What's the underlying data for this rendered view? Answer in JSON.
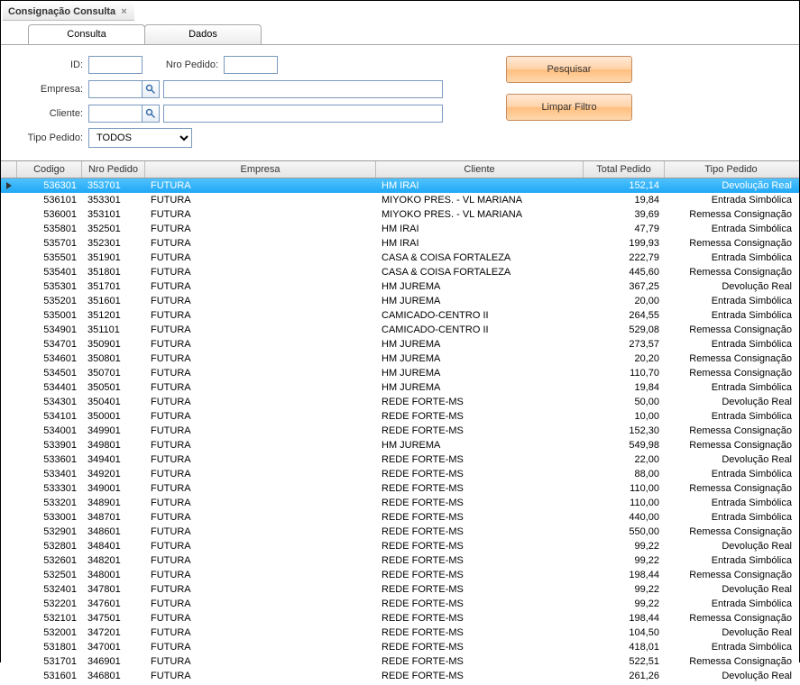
{
  "window": {
    "title": "Consignação Consulta"
  },
  "tabs": [
    {
      "label": "Consulta",
      "active": true
    },
    {
      "label": "Dados",
      "active": false
    }
  ],
  "form": {
    "id_label": "ID:",
    "id_value": "",
    "nro_label": "Nro Pedido:",
    "nro_value": "",
    "empresa_label": "Empresa:",
    "empresa_code": "",
    "empresa_name": "",
    "cliente_label": "Cliente:",
    "cliente_code": "",
    "cliente_name": "",
    "tipo_label": "Tipo Pedido:",
    "tipo_value": "TODOS"
  },
  "buttons": {
    "search": "Pesquisar",
    "clear": "Limpar Filtro"
  },
  "grid": {
    "columns": [
      "Codigo",
      "Nro Pedido",
      "Empresa",
      "Cliente",
      "Total Pedido",
      "Tipo Pedido"
    ],
    "rows": [
      {
        "codigo": "536301",
        "nro": "353701",
        "empresa": "FUTURA",
        "cliente": "HM IRAI",
        "total": "152,14",
        "tipo": "Devolução Real",
        "selected": true
      },
      {
        "codigo": "536101",
        "nro": "353301",
        "empresa": "FUTURA",
        "cliente": "MIYOKO PRES. - VL MARIANA",
        "total": "19,84",
        "tipo": "Entrada Simbólica"
      },
      {
        "codigo": "536001",
        "nro": "353101",
        "empresa": "FUTURA",
        "cliente": "MIYOKO PRES. - VL MARIANA",
        "total": "39,69",
        "tipo": "Remessa Consignação"
      },
      {
        "codigo": "535801",
        "nro": "352501",
        "empresa": "FUTURA",
        "cliente": "HM IRAI",
        "total": "47,79",
        "tipo": "Entrada Simbólica"
      },
      {
        "codigo": "535701",
        "nro": "352301",
        "empresa": "FUTURA",
        "cliente": "HM IRAI",
        "total": "199,93",
        "tipo": "Remessa Consignação"
      },
      {
        "codigo": "535501",
        "nro": "351901",
        "empresa": "FUTURA",
        "cliente": "CASA & COISA FORTALEZA",
        "total": "222,79",
        "tipo": "Entrada Simbólica"
      },
      {
        "codigo": "535401",
        "nro": "351801",
        "empresa": "FUTURA",
        "cliente": "CASA & COISA FORTALEZA",
        "total": "445,60",
        "tipo": "Remessa Consignação"
      },
      {
        "codigo": "535301",
        "nro": "351701",
        "empresa": "FUTURA",
        "cliente": "HM JUREMA",
        "total": "367,25",
        "tipo": "Devolução Real"
      },
      {
        "codigo": "535201",
        "nro": "351601",
        "empresa": "FUTURA",
        "cliente": "HM JUREMA",
        "total": "20,00",
        "tipo": "Entrada Simbólica"
      },
      {
        "codigo": "535001",
        "nro": "351201",
        "empresa": "FUTURA",
        "cliente": "CAMICADO-CENTRO II",
        "total": "264,55",
        "tipo": "Entrada Simbólica"
      },
      {
        "codigo": "534901",
        "nro": "351101",
        "empresa": "FUTURA",
        "cliente": "CAMICADO-CENTRO II",
        "total": "529,08",
        "tipo": "Remessa Consignação"
      },
      {
        "codigo": "534701",
        "nro": "350901",
        "empresa": "FUTURA",
        "cliente": "HM JUREMA",
        "total": "273,57",
        "tipo": "Entrada Simbólica"
      },
      {
        "codigo": "534601",
        "nro": "350801",
        "empresa": "FUTURA",
        "cliente": "HM JUREMA",
        "total": "20,20",
        "tipo": "Remessa Consignação"
      },
      {
        "codigo": "534501",
        "nro": "350701",
        "empresa": "FUTURA",
        "cliente": "HM JUREMA",
        "total": "110,70",
        "tipo": "Remessa Consignação"
      },
      {
        "codigo": "534401",
        "nro": "350501",
        "empresa": "FUTURA",
        "cliente": "HM JUREMA",
        "total": "19,84",
        "tipo": "Entrada Simbólica"
      },
      {
        "codigo": "534301",
        "nro": "350401",
        "empresa": "FUTURA",
        "cliente": "REDE FORTE-MS",
        "total": "50,00",
        "tipo": "Devolução Real"
      },
      {
        "codigo": "534101",
        "nro": "350001",
        "empresa": "FUTURA",
        "cliente": "REDE FORTE-MS",
        "total": "10,00",
        "tipo": "Entrada Simbólica"
      },
      {
        "codigo": "534001",
        "nro": "349901",
        "empresa": "FUTURA",
        "cliente": "REDE FORTE-MS",
        "total": "152,30",
        "tipo": "Remessa Consignação"
      },
      {
        "codigo": "533901",
        "nro": "349801",
        "empresa": "FUTURA",
        "cliente": "HM JUREMA",
        "total": "549,98",
        "tipo": "Remessa Consignação"
      },
      {
        "codigo": "533601",
        "nro": "349401",
        "empresa": "FUTURA",
        "cliente": "REDE FORTE-MS",
        "total": "22,00",
        "tipo": "Devolução Real"
      },
      {
        "codigo": "533401",
        "nro": "349201",
        "empresa": "FUTURA",
        "cliente": "REDE FORTE-MS",
        "total": "88,00",
        "tipo": "Entrada Simbólica"
      },
      {
        "codigo": "533301",
        "nro": "349001",
        "empresa": "FUTURA",
        "cliente": "REDE FORTE-MS",
        "total": "110,00",
        "tipo": "Remessa Consignação"
      },
      {
        "codigo": "533201",
        "nro": "348901",
        "empresa": "FUTURA",
        "cliente": "REDE FORTE-MS",
        "total": "110,00",
        "tipo": "Entrada Simbólica"
      },
      {
        "codigo": "533001",
        "nro": "348701",
        "empresa": "FUTURA",
        "cliente": "REDE FORTE-MS",
        "total": "440,00",
        "tipo": "Entrada Simbólica"
      },
      {
        "codigo": "532901",
        "nro": "348601",
        "empresa": "FUTURA",
        "cliente": "REDE FORTE-MS",
        "total": "550,00",
        "tipo": "Remessa Consignação"
      },
      {
        "codigo": "532801",
        "nro": "348401",
        "empresa": "FUTURA",
        "cliente": "REDE FORTE-MS",
        "total": "99,22",
        "tipo": "Devolução Real"
      },
      {
        "codigo": "532601",
        "nro": "348201",
        "empresa": "FUTURA",
        "cliente": "REDE FORTE-MS",
        "total": "99,22",
        "tipo": "Entrada Simbólica"
      },
      {
        "codigo": "532501",
        "nro": "348001",
        "empresa": "FUTURA",
        "cliente": "REDE FORTE-MS",
        "total": "198,44",
        "tipo": "Remessa Consignação"
      },
      {
        "codigo": "532401",
        "nro": "347801",
        "empresa": "FUTURA",
        "cliente": "REDE FORTE-MS",
        "total": "99,22",
        "tipo": "Devolução Real"
      },
      {
        "codigo": "532201",
        "nro": "347601",
        "empresa": "FUTURA",
        "cliente": "REDE FORTE-MS",
        "total": "99,22",
        "tipo": "Entrada Simbólica"
      },
      {
        "codigo": "532101",
        "nro": "347501",
        "empresa": "FUTURA",
        "cliente": "REDE FORTE-MS",
        "total": "198,44",
        "tipo": "Remessa Consignação"
      },
      {
        "codigo": "532001",
        "nro": "347201",
        "empresa": "FUTURA",
        "cliente": "REDE FORTE-MS",
        "total": "104,50",
        "tipo": "Devolução Real"
      },
      {
        "codigo": "531801",
        "nro": "347001",
        "empresa": "FUTURA",
        "cliente": "REDE FORTE-MS",
        "total": "418,01",
        "tipo": "Entrada Simbólica"
      },
      {
        "codigo": "531701",
        "nro": "346901",
        "empresa": "FUTURA",
        "cliente": "REDE FORTE-MS",
        "total": "522,51",
        "tipo": "Remessa Consignação"
      },
      {
        "codigo": "531601",
        "nro": "346801",
        "empresa": "FUTURA",
        "cliente": "REDE FORTE-MS",
        "total": "261,26",
        "tipo": "Devolução Real"
      }
    ]
  }
}
